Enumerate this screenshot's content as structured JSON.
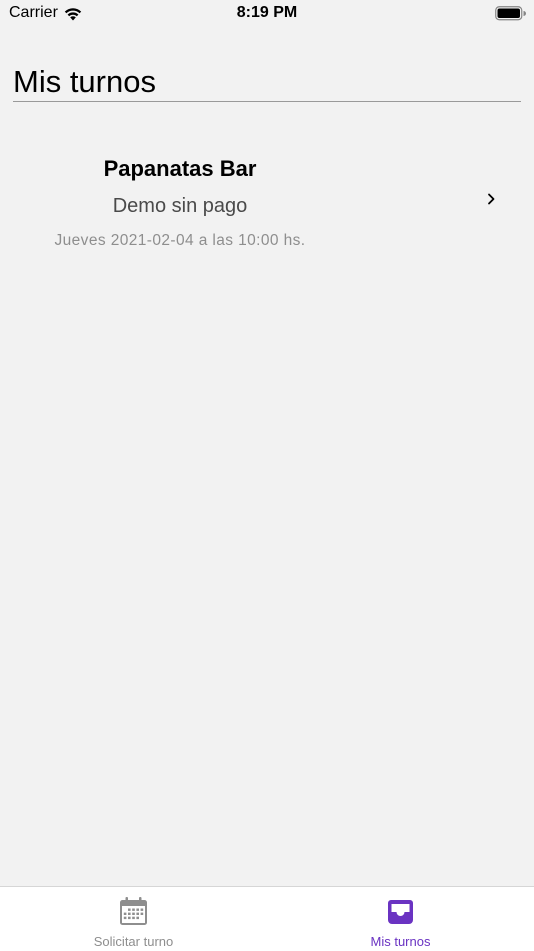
{
  "status_bar": {
    "carrier": "Carrier",
    "time": "8:19 PM",
    "wifi_icon": "wifi-icon",
    "battery_icon": "battery-icon"
  },
  "header": {
    "title": "Mis turnos"
  },
  "appointments": [
    {
      "venue": "Papanatas Bar",
      "description": "Demo sin pago",
      "date": "Jueves 2021-02-04 a las 10:00 hs."
    }
  ],
  "tab_bar": {
    "tabs": [
      {
        "label": "Solicitar turno",
        "icon": "calendar-icon",
        "selected": false
      },
      {
        "label": "Mis turnos",
        "icon": "inbox-tray-icon",
        "selected": true
      }
    ]
  },
  "colors": {
    "accent": "#6a33c2",
    "inactive": "#8e8e8e",
    "background": "#f2f2f2"
  }
}
